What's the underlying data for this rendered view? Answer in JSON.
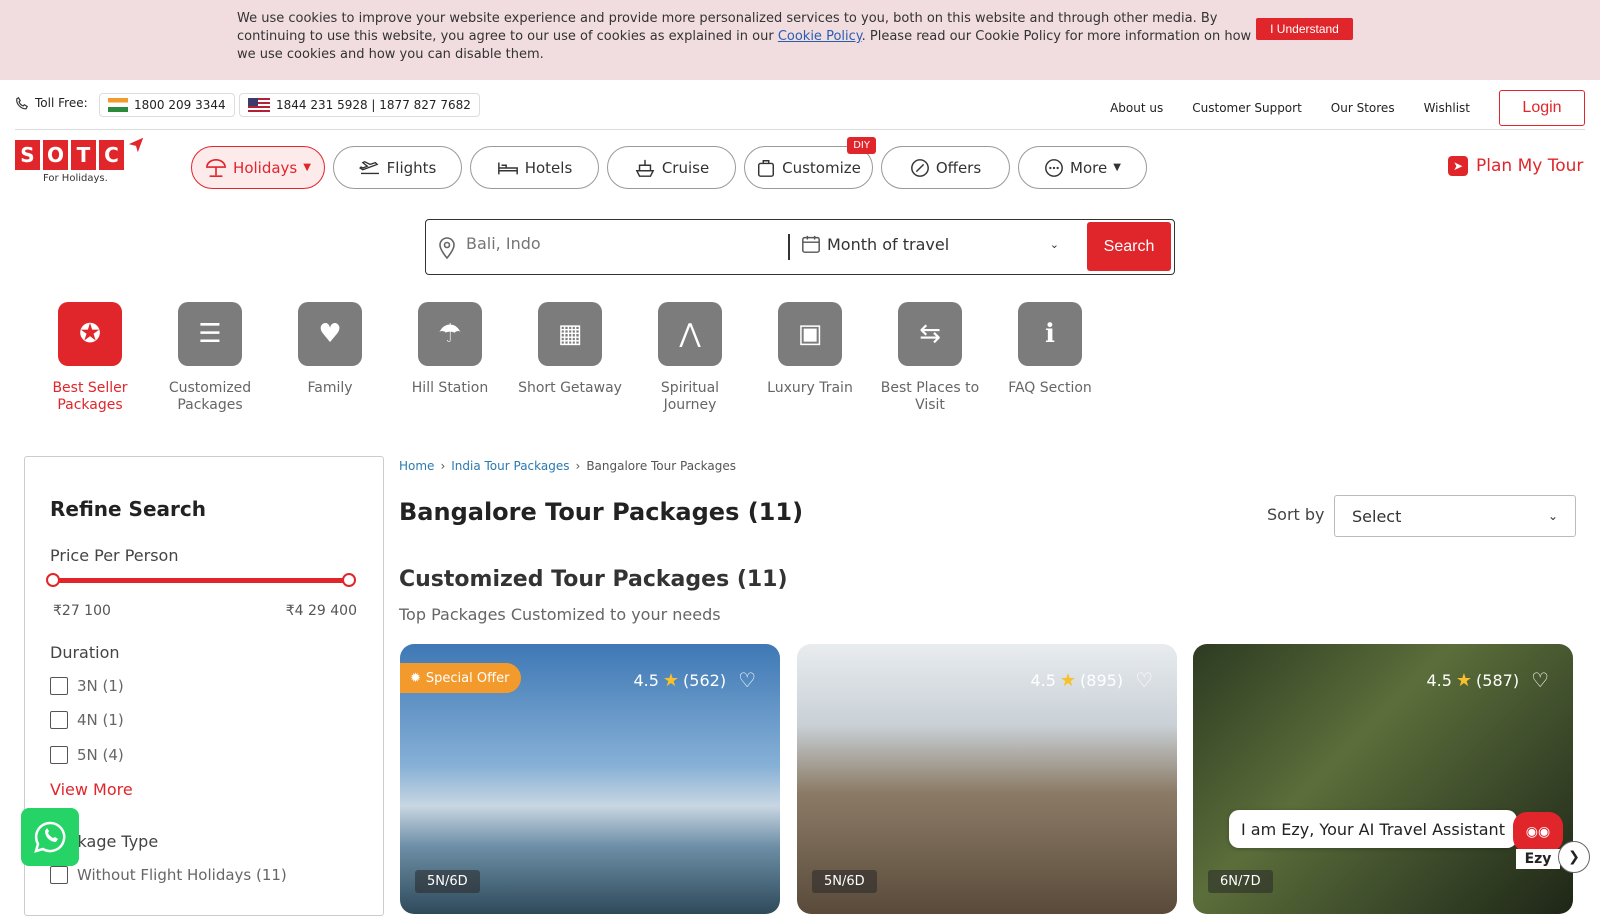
{
  "cookie": {
    "text_before": "We use cookies to improve your website experience and provide more personalized services to you, both on this website and through other media. By continuing to use this website, you agree to our use of cookies as explained in our ",
    "link": "Cookie Policy",
    "text_after": ". Please read our Cookie Policy for more information on how we use cookies and how you can disable them.",
    "button": "I Understand"
  },
  "topbar": {
    "toll_free_label": "Toll Free:",
    "india_phone": "1800 209 3344",
    "us_phone": "1844 231 5928 | 1877 827 7682",
    "links": [
      "About us",
      "Customer Support",
      "Our Stores",
      "Wishlist"
    ],
    "login": "Login"
  },
  "header": {
    "logo_letters": [
      "S",
      "O",
      "T",
      "C"
    ],
    "logo_sub": "For Holidays.",
    "nav": [
      {
        "label": "Holidays",
        "icon": "umbrella-icon"
      },
      {
        "label": "Flights",
        "icon": "plane-icon"
      },
      {
        "label": "Hotels",
        "icon": "bed-icon"
      },
      {
        "label": "Cruise",
        "icon": "ship-icon"
      },
      {
        "label": "Customize",
        "icon": "bag-icon",
        "badge": "DIY"
      },
      {
        "label": "Offers",
        "icon": "percent-icon"
      },
      {
        "label": "More",
        "icon": "dots-icon"
      }
    ],
    "plan": "Plan My Tour"
  },
  "search": {
    "placeholder": "Bali, Indo",
    "month_label": "Month of travel",
    "button": "Search"
  },
  "categories": [
    {
      "label": "Best Seller Packages",
      "icon": "badge-icon"
    },
    {
      "label": "Customized Packages",
      "icon": "sliders-icon"
    },
    {
      "label": "Family",
      "icon": "family-icon"
    },
    {
      "label": "Hill Station",
      "icon": "beach-icon"
    },
    {
      "label": "Short Getaway",
      "icon": "suitcase-icon"
    },
    {
      "label": "Spiritual Journey",
      "icon": "pray-icon"
    },
    {
      "label": "Luxury Train",
      "icon": "train-icon"
    },
    {
      "label": "Best Places to Visit",
      "icon": "signpost-icon"
    },
    {
      "label": "FAQ Section",
      "icon": "info-icon"
    }
  ],
  "sidebar": {
    "title": "Refine Search",
    "price_label": "Price Per Person",
    "price_min": "₹27 100",
    "price_max": "₹4 29 400",
    "duration_label": "Duration",
    "durations": [
      "3N (1)",
      "4N (1)",
      "5N (4)"
    ],
    "view_more": "View More",
    "package_type_label": "Package Type",
    "package_types": [
      "Without Flight Holidays (11)"
    ]
  },
  "main": {
    "breadcrumb": [
      "Home",
      "India Tour Packages",
      "Bangalore Tour Packages"
    ],
    "title": "Bangalore Tour Packages (11)",
    "sort_label": "Sort by",
    "sort_value": "Select",
    "section_title": "Customized Tour Packages (11)",
    "section_sub": "Top Packages Customized to your needs",
    "cards": [
      {
        "offer": "Special Offer",
        "rating": "4.5",
        "reviews": "(562)",
        "duration": "5N/6D"
      },
      {
        "offer": "",
        "rating": "4.5",
        "reviews": "(895)",
        "duration": "5N/6D"
      },
      {
        "offer": "",
        "rating": "4.5",
        "reviews": "(587)",
        "duration": "6N/7D"
      }
    ]
  },
  "assistant": {
    "bubble": "I am Ezy, Your AI Travel Assistant",
    "name": "Ezy"
  },
  "colors": {
    "brand": "#e0262b",
    "offer": "#f39a2c",
    "whatsapp": "#25d366"
  }
}
